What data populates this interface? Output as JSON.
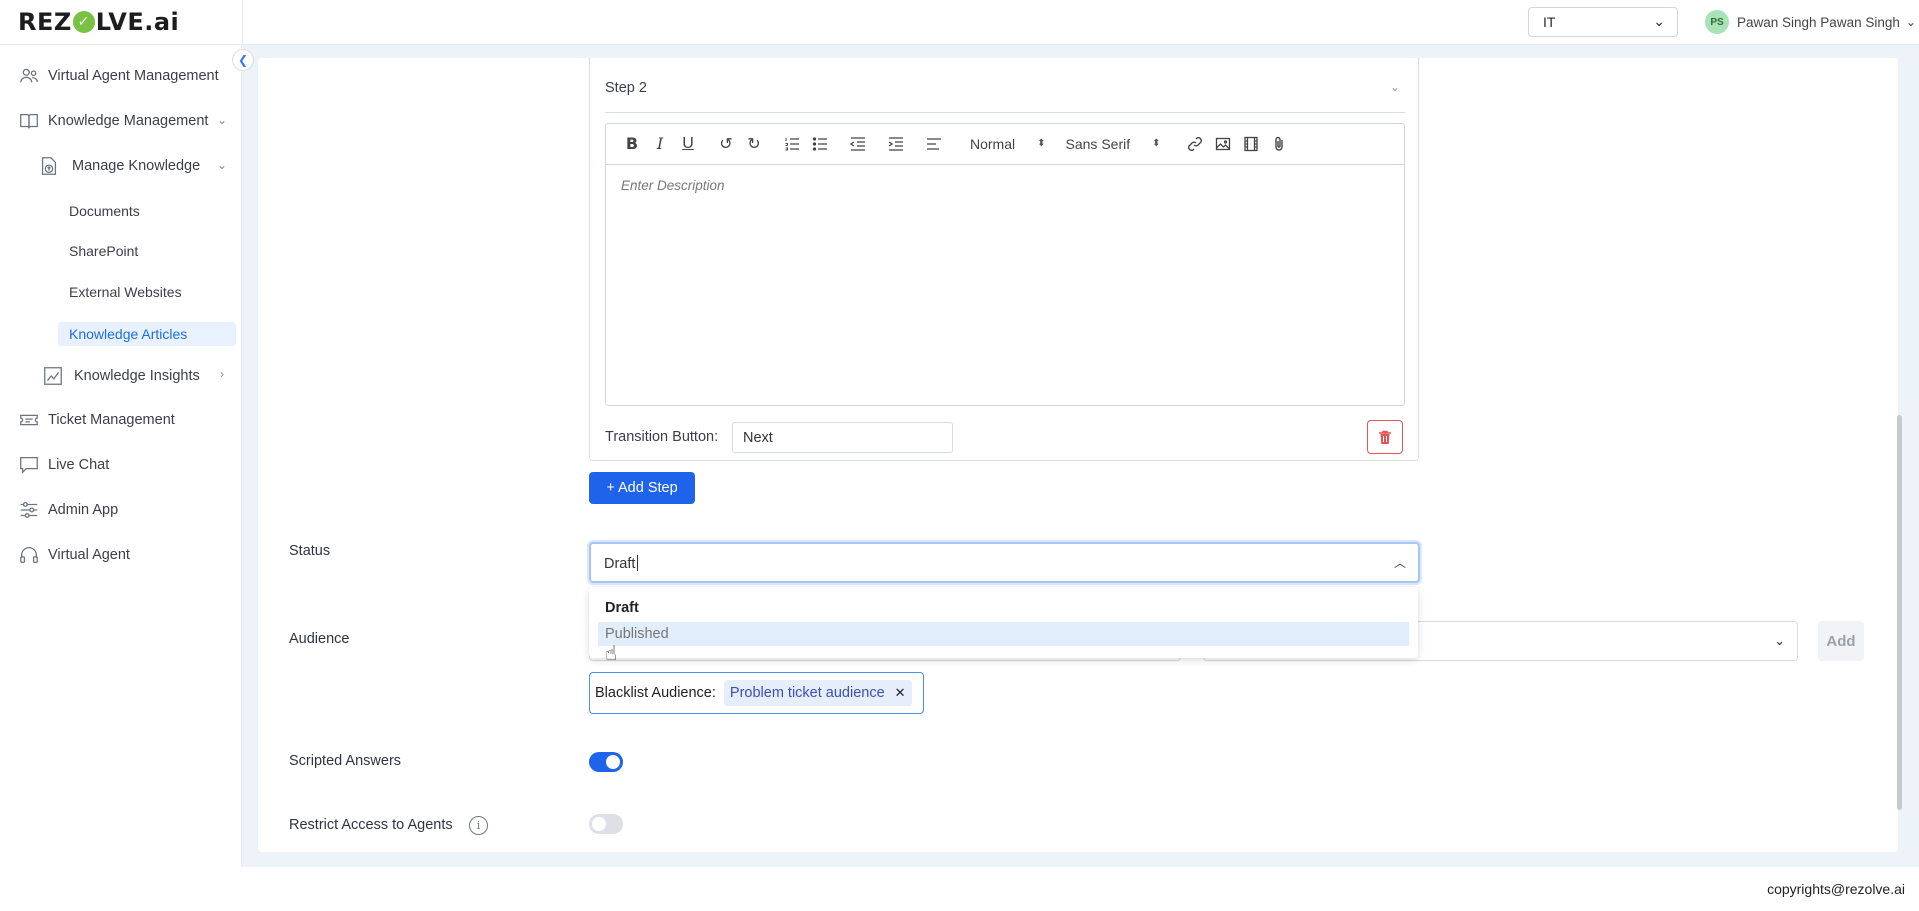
{
  "header": {
    "logo_text_a": "REZ",
    "logo_text_b": "LVE.ai",
    "lang": "IT",
    "user_initials": "PS",
    "user_name": "Pawan Singh Pawan Singh"
  },
  "sidebar": {
    "items": [
      {
        "label": "Virtual Agent Management",
        "icon": "users-icon"
      },
      {
        "label": "Knowledge Management",
        "icon": "book-icon"
      },
      {
        "label": "Manage Knowledge",
        "icon": "upload-icon"
      },
      {
        "label": "Documents"
      },
      {
        "label": "SharePoint"
      },
      {
        "label": "External Websites"
      },
      {
        "label": "Knowledge Articles",
        "active": true
      },
      {
        "label": "Knowledge Insights",
        "icon": "chart-icon"
      },
      {
        "label": "Ticket Management",
        "icon": "ticket-icon"
      },
      {
        "label": "Live Chat",
        "icon": "chat-icon"
      },
      {
        "label": "Admin App",
        "icon": "sliders-icon"
      },
      {
        "label": "Virtual Agent",
        "icon": "headset-icon"
      }
    ]
  },
  "step": {
    "title": "Step 2",
    "editor": {
      "format": "Normal",
      "font": "Sans Serif",
      "placeholder": "Enter Description"
    },
    "transition_label": "Transition Button:",
    "transition_value": "Next"
  },
  "add_step_label": "+ Add Step",
  "status": {
    "label": "Status",
    "value": "Draft",
    "options": [
      "Draft",
      "Published"
    ],
    "selected": "Draft",
    "hovered": "Published"
  },
  "audience": {
    "label": "Audience",
    "add_label": "Add",
    "blacklist_label": "Blacklist Audience:",
    "blacklist_chips": [
      "Problem ticket audience"
    ]
  },
  "scripted_answers": {
    "label": "Scripted Answers",
    "enabled": true
  },
  "restrict_access": {
    "label": "Restrict Access to Agents",
    "enabled": false
  },
  "footer": {
    "copyright": "copyrights@rezolve.ai"
  },
  "colors": {
    "primary": "#1e63e9",
    "active_link": "#1d6fe0",
    "danger": "#e05555",
    "logo_check": "#79c143"
  }
}
